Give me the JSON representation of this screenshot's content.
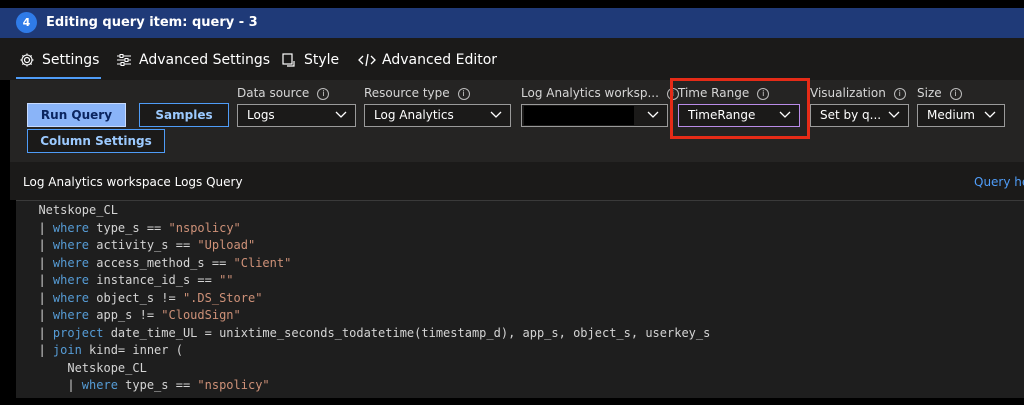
{
  "title_bar": {
    "step": "4",
    "title": "Editing query item: query - 3"
  },
  "tabs": [
    {
      "label": "Settings",
      "icon": "gear-icon",
      "active": true
    },
    {
      "label": "Advanced Settings",
      "icon": "sliders-icon",
      "active": false
    },
    {
      "label": "Style",
      "icon": "style-icon",
      "active": false
    },
    {
      "label": "Advanced Editor",
      "icon": "code-icon",
      "active": false
    }
  ],
  "buttons": {
    "run_query": "Run Query",
    "samples": "Samples",
    "column_settings": "Column Settings"
  },
  "fields": {
    "data_source": {
      "label": "Data source",
      "value": "Logs"
    },
    "resource_type": {
      "label": "Resource type",
      "value": "Log Analytics"
    },
    "workspace": {
      "label": "Log Analytics worksp...",
      "value": ""
    },
    "time_range": {
      "label": "Time Range",
      "value": "TimeRange"
    },
    "visualization": {
      "label": "Visualization",
      "value": "Set by q..."
    },
    "size": {
      "label": "Size",
      "value": "Medium"
    }
  },
  "query": {
    "title": "Log Analytics workspace Logs Query",
    "help_link": "Query he"
  },
  "code_lines": [
    [
      {
        "t": "  Netskope_CL",
        "c": ""
      }
    ],
    [
      {
        "t": "  | ",
        "c": ""
      },
      {
        "t": "where",
        "c": "kw"
      },
      {
        "t": " type_s == ",
        "c": ""
      },
      {
        "t": "\"nspolicy\"",
        "c": "str"
      }
    ],
    [
      {
        "t": "  | ",
        "c": ""
      },
      {
        "t": "where",
        "c": "kw"
      },
      {
        "t": " activity_s == ",
        "c": ""
      },
      {
        "t": "\"Upload\"",
        "c": "str"
      }
    ],
    [
      {
        "t": "  | ",
        "c": ""
      },
      {
        "t": "where",
        "c": "kw"
      },
      {
        "t": " access_method_s == ",
        "c": ""
      },
      {
        "t": "\"Client\"",
        "c": "str"
      }
    ],
    [
      {
        "t": "  | ",
        "c": ""
      },
      {
        "t": "where",
        "c": "kw"
      },
      {
        "t": " instance_id_s == ",
        "c": ""
      },
      {
        "t": "\"\"",
        "c": "str"
      }
    ],
    [
      {
        "t": "  | ",
        "c": ""
      },
      {
        "t": "where",
        "c": "kw"
      },
      {
        "t": " object_s != ",
        "c": ""
      },
      {
        "t": "\".DS_Store\"",
        "c": "str"
      }
    ],
    [
      {
        "t": "  | ",
        "c": ""
      },
      {
        "t": "where",
        "c": "kw"
      },
      {
        "t": " app_s != ",
        "c": ""
      },
      {
        "t": "\"CloudSign\"",
        "c": "str"
      }
    ],
    [
      {
        "t": "  | ",
        "c": ""
      },
      {
        "t": "project",
        "c": "kw"
      },
      {
        "t": " date_time_UL = unixtime_seconds_todatetime(timestamp_d), app_s, object_s, userkey_s",
        "c": ""
      }
    ],
    [
      {
        "t": "  | ",
        "c": ""
      },
      {
        "t": "join",
        "c": "kw"
      },
      {
        "t": " kind= inner (",
        "c": ""
      }
    ],
    [
      {
        "t": "      Netskope_CL",
        "c": ""
      }
    ],
    [
      {
        "t": "      | ",
        "c": ""
      },
      {
        "t": "where",
        "c": "kw"
      },
      {
        "t": " type_s == ",
        "c": ""
      },
      {
        "t": "\"nspolicy\"",
        "c": "str"
      }
    ]
  ],
  "colors": {
    "accent": "#4f9cf7",
    "highlight": "#e52b17",
    "keyword": "#569cd6",
    "string": "#ce9178"
  }
}
